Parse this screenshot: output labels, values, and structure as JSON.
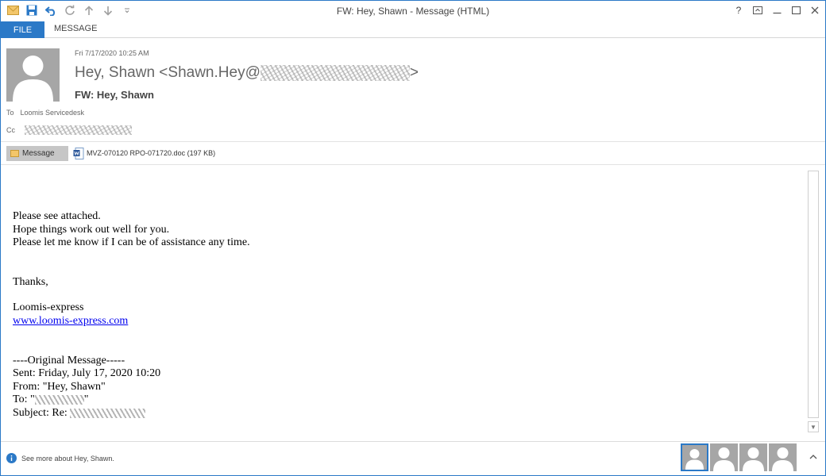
{
  "window": {
    "title": "FW: Hey, Shawn - Message (HTML)"
  },
  "ribbon": {
    "file_tab": "FILE",
    "message_tab": "MESSAGE"
  },
  "header": {
    "date": "Fri 7/17/2020 10:25 AM",
    "sender_prefix": "Hey, Shawn <Shawn.Hey@",
    "sender_suffix": ">",
    "subject": "FW: Hey, Shawn",
    "to_label": "To",
    "to_value": "Loomis Servicedesk",
    "cc_label": "Cc"
  },
  "attachments": {
    "message_label": "Message",
    "file_name": "MVZ-070120 RPO-071720.doc (197 KB)"
  },
  "body": {
    "line1": "Please see attached.",
    "line2": "Hope things work out well for you.",
    "line3": "Please let me know if I can be of assistance any time.",
    "thanks": "Thanks,",
    "company": "Loomis-express",
    "link": "www.loomis-express.com",
    "original_header": "----Original Message-----",
    "sent": "Sent: Friday, July 17, 2020 10:20",
    "from": "From: \"Hey, Shawn\"",
    "to_prefix": "To: \"",
    "to_suffix": "\"",
    "subject_prefix": "Subject: Re: "
  },
  "people_pane": {
    "info_text": "See more about Hey, Shawn."
  },
  "colors": {
    "accent": "#2b79c7",
    "link": "#0000ee"
  }
}
